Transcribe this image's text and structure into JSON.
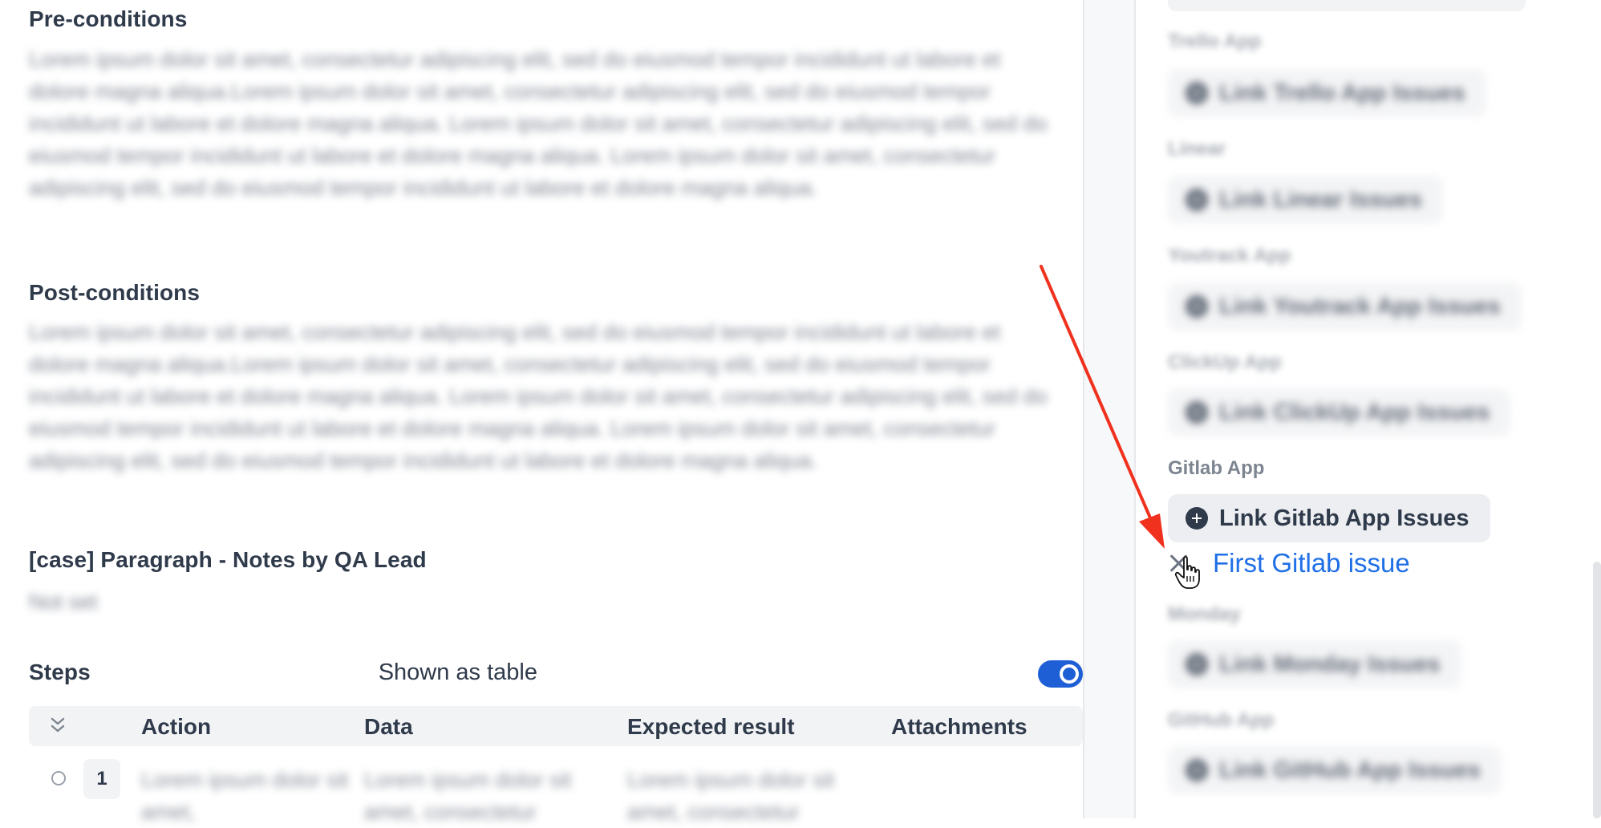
{
  "main": {
    "preconditions": {
      "title": "Pre-conditions",
      "body": "Lorem ipsum dolor sit amet, consectetur adipiscing elit, sed do eiusmod tempor incididunt ut labore et dolore magna aliqua.Lorem ipsum dolor sit amet, consectetur adipiscing elit, sed do eiusmod tempor incididunt ut labore et dolore magna aliqua. Lorem ipsum dolor sit amet, consectetur adipiscing elit, sed do eiusmod tempor incididunt ut labore et dolore magna aliqua. Lorem ipsum dolor sit amet, consectetur adipiscing elit, sed do eiusmod tempor incididunt ut labore et dolore magna aliqua."
    },
    "postconditions": {
      "title": "Post-conditions",
      "body": "Lorem ipsum dolor sit amet, consectetur adipiscing elit, sed do eiusmod tempor incididunt ut labore et dolore magna aliqua.Lorem ipsum dolor sit amet, consectetur adipiscing elit, sed do eiusmod tempor incididunt ut labore et dolore magna aliqua. Lorem ipsum dolor sit amet, consectetur adipiscing elit, sed do eiusmod tempor incididunt ut labore et dolore magna aliqua. Lorem ipsum dolor sit amet, consectetur adipiscing elit, sed do eiusmod tempor incididunt ut labore et dolore magna aliqua."
    },
    "notes": {
      "title": "[case] Paragraph - Notes by QA Lead",
      "value": "Not set"
    },
    "steps": {
      "title": "Steps",
      "toggle_label": "Shown as table",
      "toggle_on": true,
      "columns": [
        "Action",
        "Data",
        "Expected result",
        "Attachments"
      ],
      "rows": [
        {
          "number": "1",
          "action": "Lorem ipsum dolor sit amet,",
          "data": "Lorem ipsum dolor sit amet, consectetur",
          "expected": "Lorem ipsum dolor sit amet, consectetur"
        }
      ]
    }
  },
  "sidebar": {
    "integrations": [
      {
        "label": "Trello App",
        "button": "Link Trello App Issues",
        "blurred": true
      },
      {
        "label": "Linear",
        "button": "Link Linear Issues",
        "blurred": true
      },
      {
        "label": "Youtrack App",
        "button": "Link Youtrack App Issues",
        "blurred": true
      },
      {
        "label": "ClickUp App",
        "button": "Link ClickUp App Issues",
        "blurred": true
      },
      {
        "label": "Gitlab App",
        "button": "Link Gitlab App Issues",
        "blurred": false
      },
      {
        "label": "Monday",
        "button": "Link Monday Issues",
        "blurred": true
      },
      {
        "label": "GitHub App",
        "button": "Link GitHub App Issues",
        "blurred": true
      }
    ],
    "linked_issue": {
      "title": "First Gitlab issue"
    }
  },
  "colors": {
    "accent": "#1f5fd6",
    "link": "#1f6fe6",
    "annotation_arrow": "#f0311e"
  },
  "icons": [
    "plus-circle-icon",
    "close-icon",
    "chevrons-collapse-icon",
    "hand-pointer-cursor-icon"
  ]
}
